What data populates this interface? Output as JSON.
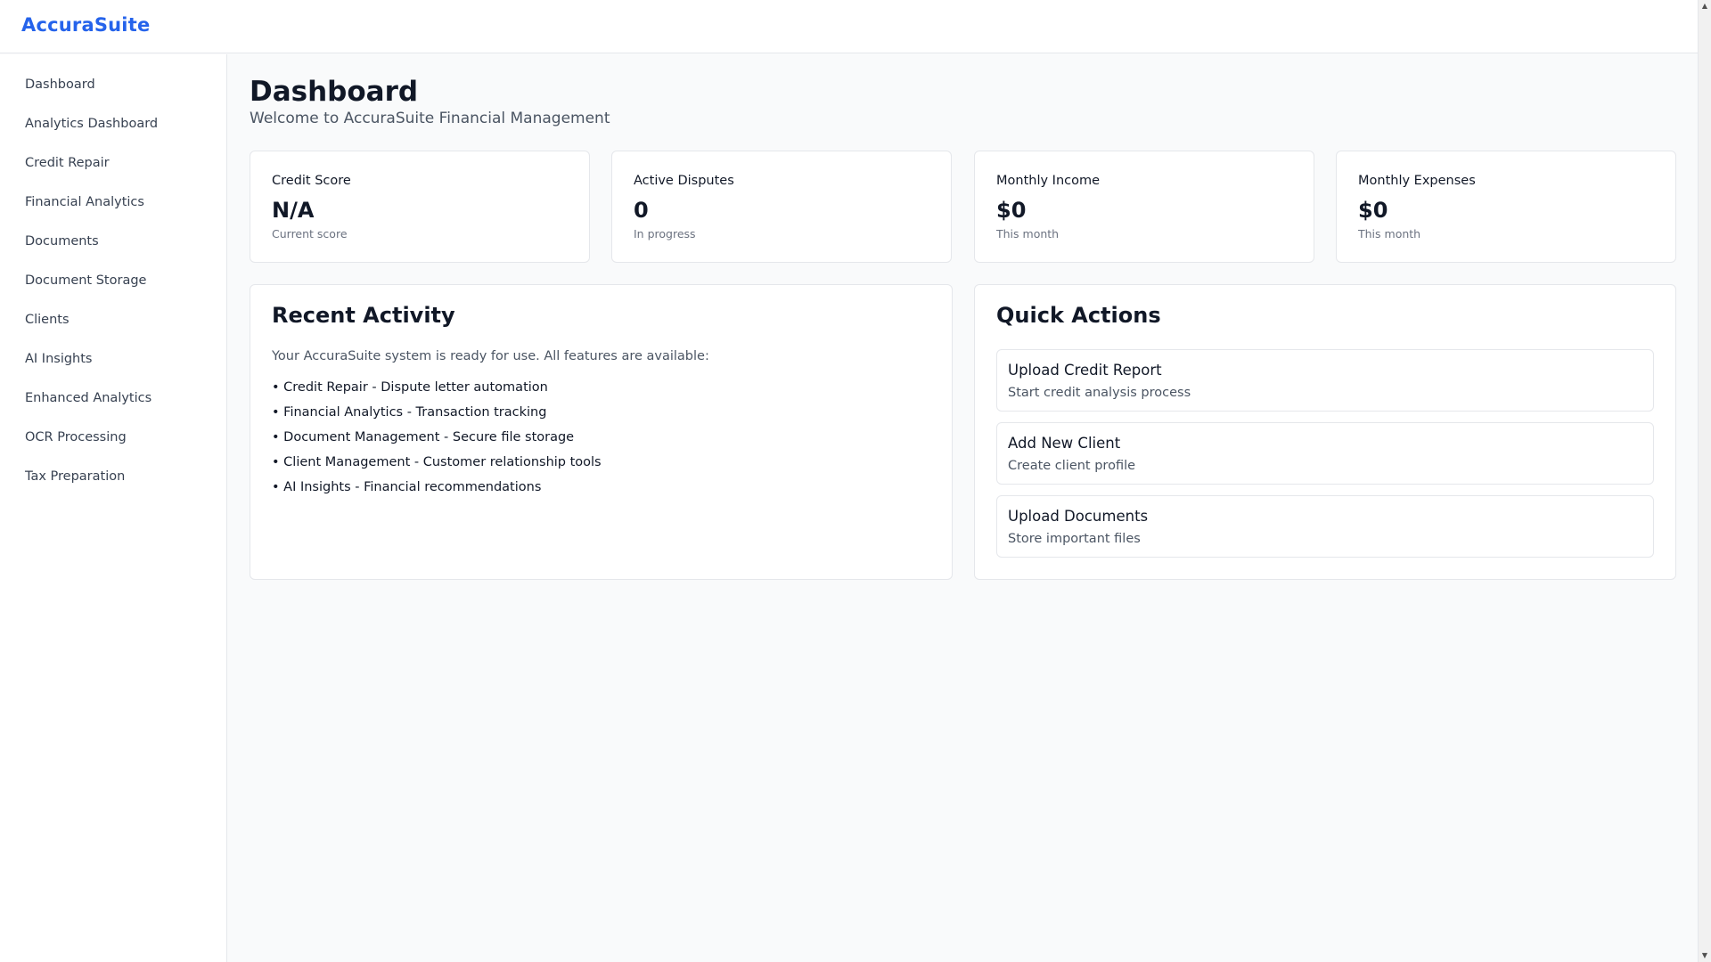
{
  "app": {
    "brand": "AccuraSuite"
  },
  "sidebar": {
    "items": [
      {
        "label": "Dashboard"
      },
      {
        "label": "Analytics Dashboard"
      },
      {
        "label": "Credit Repair"
      },
      {
        "label": "Financial Analytics"
      },
      {
        "label": "Documents"
      },
      {
        "label": "Document Storage"
      },
      {
        "label": "Clients"
      },
      {
        "label": "AI Insights"
      },
      {
        "label": "Enhanced Analytics"
      },
      {
        "label": "OCR Processing"
      },
      {
        "label": "Tax Preparation"
      }
    ]
  },
  "page": {
    "title": "Dashboard",
    "subtitle": "Welcome to AccuraSuite Financial Management"
  },
  "stats": [
    {
      "label": "Credit Score",
      "value": "N/A",
      "note": "Current score"
    },
    {
      "label": "Active Disputes",
      "value": "0",
      "note": "In progress"
    },
    {
      "label": "Monthly Income",
      "value": "$0",
      "note": "This month"
    },
    {
      "label": "Monthly Expenses",
      "value": "$0",
      "note": "This month"
    }
  ],
  "recent_activity": {
    "title": "Recent Activity",
    "intro": "Your AccuraSuite system is ready for use. All features are available:",
    "features": [
      "• Credit Repair - Dispute letter automation",
      "• Financial Analytics - Transaction tracking",
      "• Document Management - Secure file storage",
      "• Client Management - Customer relationship tools",
      "• AI Insights - Financial recommendations"
    ]
  },
  "quick_actions": {
    "title": "Quick Actions",
    "items": [
      {
        "title": "Upload Credit Report",
        "description": "Start credit analysis process"
      },
      {
        "title": "Add New Client",
        "description": "Create client profile"
      },
      {
        "title": "Upload Documents",
        "description": "Store important files"
      }
    ]
  },
  "colors": {
    "brand": "#2563eb",
    "background": "#f9fafb",
    "card": "#ffffff",
    "border": "#e5e7eb"
  }
}
